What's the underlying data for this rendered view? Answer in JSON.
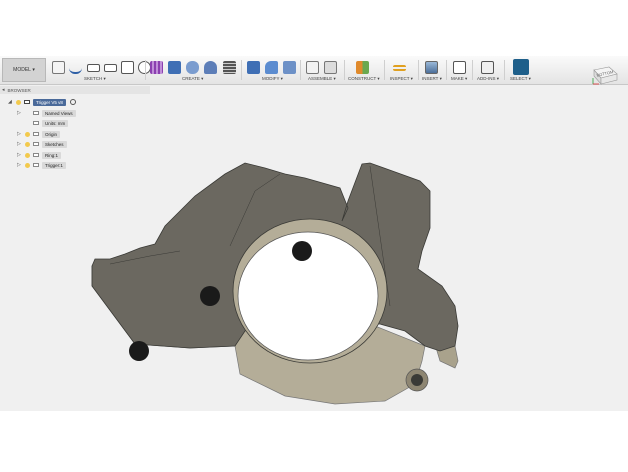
{
  "workspace": {
    "label": "MODEL"
  },
  "toolbar": {
    "groups": [
      {
        "label": "SKETCH ▾"
      },
      {
        "label": "CREATE ▾"
      },
      {
        "label": "MODIFY ▾"
      },
      {
        "label": "ASSEMBLE ▾"
      },
      {
        "label": "CONSTRUCT ▾"
      },
      {
        "label": "INSPECT ▾"
      },
      {
        "label": "INSERT ▾"
      },
      {
        "label": "MAKE ▾"
      },
      {
        "label": "ADD-INS ▾"
      },
      {
        "label": "SELECT ▾"
      }
    ]
  },
  "viewcube": {
    "face_label": "BOTTOM"
  },
  "browser": {
    "title": "BROWSER",
    "root": "Trigger V5 v8",
    "items": [
      {
        "label": "Named Views"
      },
      {
        "label": "Units: mm"
      },
      {
        "label": "Origin"
      },
      {
        "label": "Sketches"
      },
      {
        "label": "Ring:1"
      },
      {
        "label": "Trigger:1"
      }
    ]
  },
  "colors": {
    "model_top": "#6b6860",
    "model_side": "#b4ad98",
    "select_accent": "#1e5f8a"
  }
}
